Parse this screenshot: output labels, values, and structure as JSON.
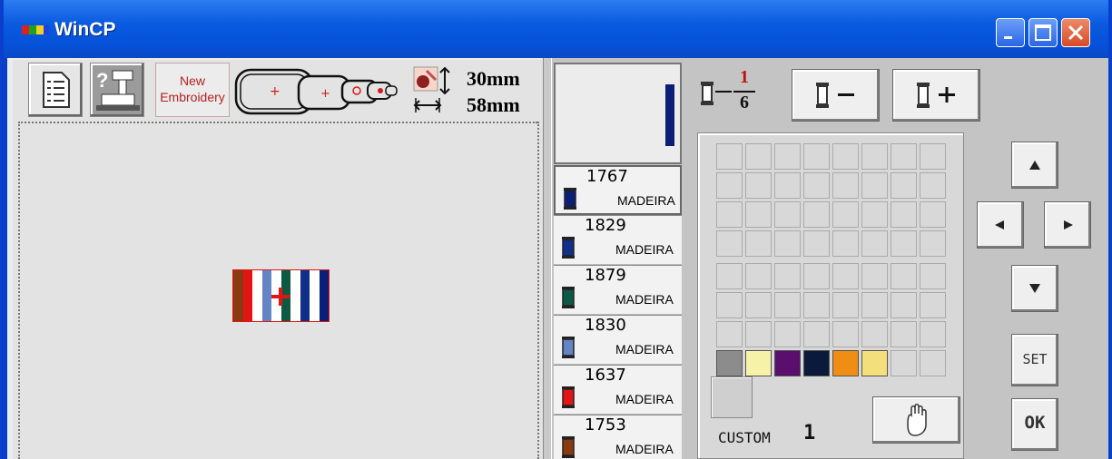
{
  "window": {
    "title": "WinCP"
  },
  "toolbar": {
    "new_embroidery_line1": "New",
    "new_embroidery_line2": "Embroidery",
    "height": "30mm",
    "width": "58mm"
  },
  "colors": [
    {
      "code": "1767",
      "brand": "MADEIRA",
      "color": "#0b1f78"
    },
    {
      "code": "1829",
      "brand": "MADEIRA",
      "color": "#102e8a"
    },
    {
      "code": "1879",
      "brand": "MADEIRA",
      "color": "#0c5a44"
    },
    {
      "code": "1830",
      "brand": "MADEIRA",
      "color": "#6484c4"
    },
    {
      "code": "1637",
      "brand": "MADEIRA",
      "color": "#e21515"
    },
    {
      "code": "1753",
      "brand": "MADEIRA",
      "color": "#8a3a10"
    }
  ],
  "color_change": {
    "current": "1",
    "total": "6"
  },
  "palette_row": [
    "#8c8c8c",
    "#f6f2a8",
    "#5a0f6e",
    "#0b1a3a",
    "#ef8d14",
    "#f4e07a"
  ],
  "custom": {
    "label": "CUSTOM",
    "number": "1"
  },
  "buttons": {
    "set": "SET",
    "ok": "OK"
  },
  "design_stripes": [
    "#8a3a10",
    "#e21515",
    "#ffffff",
    "#6484c4",
    "#ffffff",
    "#0c5a44",
    "#ffffff",
    "#102e8a",
    "#ffffff",
    "#0b1f78"
  ],
  "accent": "#0a5be0"
}
